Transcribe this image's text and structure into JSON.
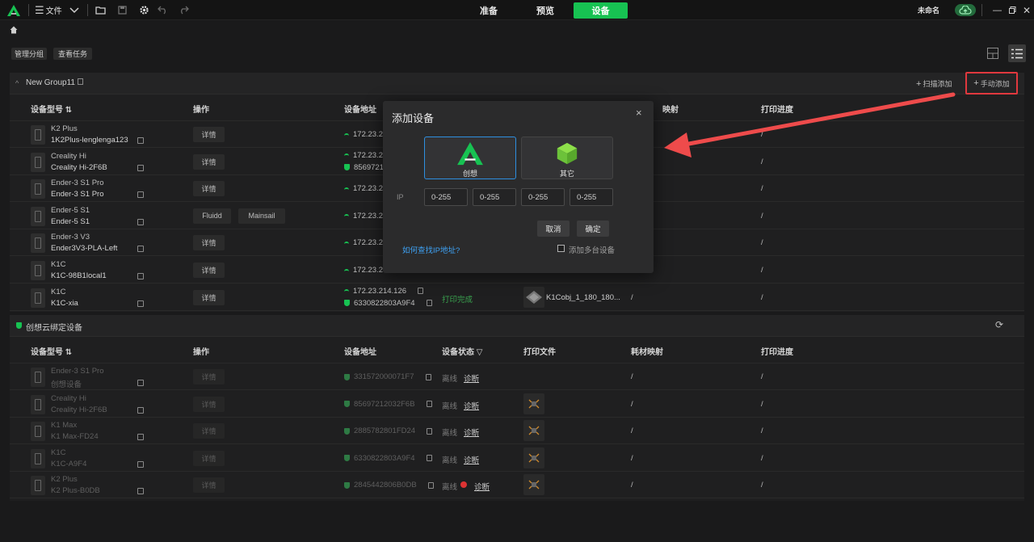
{
  "titlebar": {
    "file_label": "文件",
    "tabs": [
      "准备",
      "预览",
      "设备"
    ],
    "active_tab": "设备",
    "project_name": "未命名",
    "accent": "#17c252"
  },
  "toolbar": {
    "manage_groups": "管理分组",
    "view_tasks": "查看任务"
  },
  "group1": {
    "name": "New Group11",
    "scan_add": "扫描添加",
    "manual_add": "手动添加",
    "columns": [
      "设备型号",
      "操作",
      "设备地址",
      "映射",
      "打印进度"
    ],
    "rows": [
      {
        "model": "K2 Plus",
        "name": "1K2Plus-lenglenga123",
        "ops": [
          "详情"
        ],
        "addr1": "172.23.2",
        "addr2": "",
        "progress": "/"
      },
      {
        "model": "Creality Hi",
        "name": "Creality Hi-2F6B",
        "ops": [
          "详情"
        ],
        "addr1": "172.23.2",
        "addr2": "8569721",
        "progress": "/"
      },
      {
        "model": "Ender-3 S1 Pro",
        "name": "Ender-3 S1 Pro",
        "ops": [
          "详情"
        ],
        "addr1": "172.23.2",
        "addr2": "",
        "progress": "/"
      },
      {
        "model": "Ender-5 S1",
        "name": "Ender-5 S1",
        "ops": [
          "Fluidd",
          "Mainsail"
        ],
        "addr1": "172.23.2",
        "addr2": "",
        "progress": "/"
      },
      {
        "model": "Ender-3 V3",
        "name": "Ender3V3-PLA-Left",
        "ops": [
          "详情"
        ],
        "addr1": "172.23.2",
        "addr2": "",
        "progress": "/"
      },
      {
        "model": "K1C",
        "name": "K1C-98B1local1",
        "ops": [
          "详情"
        ],
        "addr1": "172.23.2",
        "addr2": "",
        "progress": "/"
      },
      {
        "model": "K1C",
        "name": "K1C-xia",
        "ops": [
          "详情"
        ],
        "addr1": "172.23.214.126",
        "addr2": "6330822803A9F4",
        "status": "打印完成",
        "file": "K1Cobj_1_180_180...",
        "mapping": "/",
        "progress": "/"
      }
    ]
  },
  "group2": {
    "name": "创想云绑定设备",
    "columns": [
      "设备型号",
      "操作",
      "设备地址",
      "设备状态",
      "打印文件",
      "耗材映射",
      "打印进度"
    ],
    "rows": [
      {
        "model": "Ender-3 S1 Pro",
        "name": "创想设备",
        "op": "详情",
        "addr": "331572000071F7",
        "state": "离线",
        "diag": "诊断",
        "mapping": "/",
        "progress": "/"
      },
      {
        "model": "Creality Hi",
        "name": "Creality Hi-2F6B",
        "op": "详情",
        "addr": "85697212032F6B",
        "state": "离线",
        "diag": "诊断",
        "mapping": "/",
        "progress": "/"
      },
      {
        "model": "K1 Max",
        "name": "K1 Max-FD24",
        "op": "详情",
        "addr": "2885782801FD24",
        "state": "离线",
        "diag": "诊断",
        "mapping": "/",
        "progress": "/"
      },
      {
        "model": "K1C",
        "name": "K1C-A9F4",
        "op": "详情",
        "addr": "6330822803A9F4",
        "state": "离线",
        "diag": "诊断",
        "mapping": "/",
        "progress": "/"
      },
      {
        "model": "K2 Plus",
        "name": "K2 Plus-B0DB",
        "op": "详情",
        "addr": "2845442806B0DB",
        "state": "离线",
        "diag": "诊断",
        "mapping": "/",
        "progress": "/"
      }
    ]
  },
  "dialog": {
    "title": "添加设备",
    "close": "×",
    "option_creality": "创想",
    "option_other": "其它",
    "ip_label": "IP",
    "ip_placeholder": "0-255",
    "cancel": "取消",
    "confirm": "确定",
    "help_link": "如何查找IP地址?",
    "add_multiple": "添加多台设备"
  }
}
